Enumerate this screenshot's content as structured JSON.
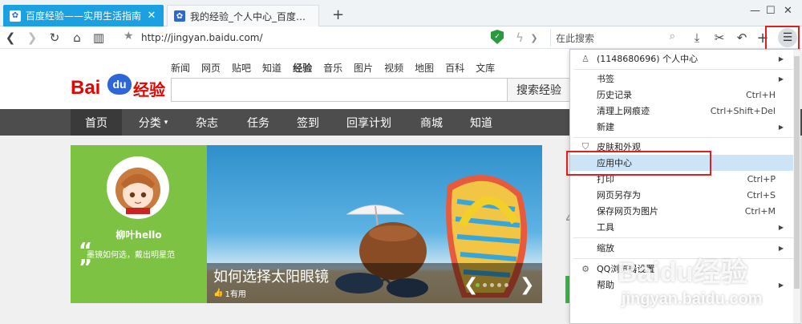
{
  "tabs": [
    {
      "title": "百度经验——实用生活指南",
      "favicon": "baidu-paw-icon",
      "active": true
    },
    {
      "title": "我的经验_个人中心_百度经验",
      "favicon": "baidu-paw-icon",
      "active": false
    }
  ],
  "toolbar": {
    "url": "http://jingyan.baidu.com/",
    "search_placeholder": "在此搜索"
  },
  "page": {
    "nav_links": [
      "新闻",
      "网页",
      "贴吧",
      "知道",
      "经验",
      "音乐",
      "图片",
      "视频",
      "地图",
      "百科",
      "文库"
    ],
    "search_button": "搜索经验",
    "logo": {
      "bai": "Bai",
      "du": "du",
      "jingyan": "经验"
    },
    "navbar": [
      "首页",
      "分类",
      "杂志",
      "任务",
      "签到",
      "回享计划",
      "商城",
      "知道"
    ],
    "profile": {
      "username": "柳叶hello",
      "quote": "墨镜如何选，戴出明星范"
    },
    "banner": {
      "title": "如何选择太阳眼镜",
      "likes": "1有用"
    },
    "side_num": "4"
  },
  "menu": {
    "items": [
      {
        "label": "(1148680696) 个人中心",
        "icon": "user-icon",
        "shortcut": "",
        "submenu": true
      },
      {
        "label": "书签",
        "icon": "",
        "shortcut": "",
        "submenu": true
      },
      {
        "label": "历史记录",
        "icon": "",
        "shortcut": "Ctrl+H",
        "submenu": false
      },
      {
        "label": "清理上网痕迹",
        "icon": "",
        "shortcut": "Ctrl+Shift+Del",
        "submenu": false
      },
      {
        "label": "新建",
        "icon": "",
        "shortcut": "",
        "submenu": true
      },
      {
        "label": "皮肤和外观",
        "icon": "shirt-icon",
        "shortcut": "",
        "submenu": false
      },
      {
        "label": "应用中心",
        "icon": "",
        "shortcut": "",
        "submenu": false,
        "highlighted": true
      },
      {
        "label": "打印",
        "icon": "",
        "shortcut": "Ctrl+P",
        "submenu": false
      },
      {
        "label": "网页另存为",
        "icon": "",
        "shortcut": "Ctrl+S",
        "submenu": false
      },
      {
        "label": "保存网页为图片",
        "icon": "",
        "shortcut": "Ctrl+M",
        "submenu": false
      },
      {
        "label": "工具",
        "icon": "",
        "shortcut": "",
        "submenu": true
      },
      {
        "label": "缩放",
        "icon": "",
        "shortcut": "",
        "submenu": true
      },
      {
        "label": "QQ浏览器设置",
        "icon": "gear-icon",
        "shortcut": "",
        "submenu": false
      },
      {
        "label": "帮助",
        "icon": "",
        "shortcut": "",
        "submenu": true
      }
    ]
  },
  "watermark": {
    "text": "Baidu经验",
    "url": "jingyan.baidu.com"
  },
  "colors": {
    "tab_active": "#1ba0e1",
    "navbar": "#4d4d4d",
    "profile_green": "#7dc243",
    "highlight": "#cde4f7",
    "annotation_red": "#e02020"
  }
}
